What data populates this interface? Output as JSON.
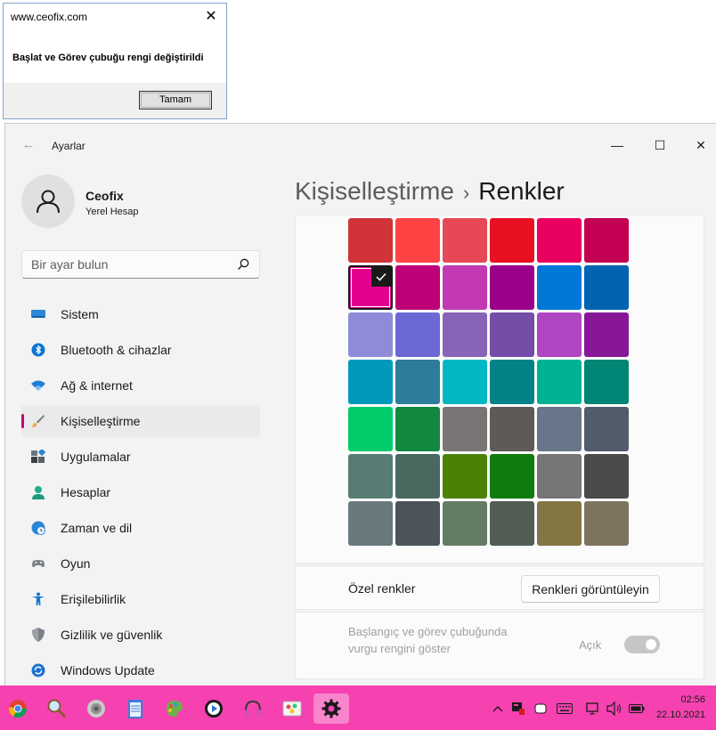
{
  "msgbox": {
    "title": "www.ceofix.com",
    "message": "Başlat ve Görev çubuğu rengi değiştirildi",
    "ok_label": "Tamam"
  },
  "settings": {
    "app_title": "Ayarlar",
    "profile": {
      "name": "Ceofix",
      "account_type": "Yerel Hesap"
    },
    "search": {
      "placeholder": "Bir ayar bulun"
    },
    "nav": [
      {
        "label": "Sistem",
        "icon": "monitor-icon",
        "active": false
      },
      {
        "label": "Bluetooth & cihazlar",
        "icon": "bluetooth-icon",
        "active": false
      },
      {
        "label": "Ağ & internet",
        "icon": "wifi-icon",
        "active": false
      },
      {
        "label": "Kişiselleştirme",
        "icon": "brush-icon",
        "active": true
      },
      {
        "label": "Uygulamalar",
        "icon": "apps-icon",
        "active": false
      },
      {
        "label": "Hesaplar",
        "icon": "person-icon",
        "active": false
      },
      {
        "label": "Zaman ve dil",
        "icon": "globe-clock-icon",
        "active": false
      },
      {
        "label": "Oyun",
        "icon": "gamepad-icon",
        "active": false
      },
      {
        "label": "Erişilebilirlik",
        "icon": "accessibility-icon",
        "active": false
      },
      {
        "label": "Gizlilik ve güvenlik",
        "icon": "shield-icon",
        "active": false
      },
      {
        "label": "Windows Update",
        "icon": "update-icon",
        "active": false
      }
    ],
    "breadcrumb": {
      "parent": "Kişiselleştirme",
      "separator": "›",
      "current": "Renkler"
    },
    "swatch_colors": [
      "#d13438",
      "#ff4343",
      "#e74856",
      "#e81123",
      "#ea005e",
      "#c30052",
      "#e3008c",
      "#bf0077",
      "#c239b3",
      "#9a0089",
      "#0078d7",
      "#0063b1",
      "#8e8cd8",
      "#6b69d6",
      "#8764b8",
      "#744da9",
      "#b146c2",
      "#881798",
      "#0099bc",
      "#2d7d9a",
      "#00b7c3",
      "#038387",
      "#00b294",
      "#018574",
      "#00cc6a",
      "#10893e",
      "#7a7574",
      "#5d5a58",
      "#68768a",
      "#515c6b",
      "#567c73",
      "#486860",
      "#498205",
      "#107c10",
      "#767676",
      "#4c4a48",
      "#69797e",
      "#4a5459",
      "#647c64",
      "#525e54",
      "#847545",
      "#7e735f"
    ],
    "selected_swatch_index": 6,
    "custom_colors": {
      "label": "Özel renkler",
      "button_label": "Renkleri görüntüleyin"
    },
    "accent_start": {
      "label": "Başlangıç ve görev çubuğunda vurgu rengini göster",
      "state_label": "Açık",
      "enabled": false
    }
  },
  "taskbar": {
    "apps": [
      "chrome-icon",
      "search-magnifier-icon",
      "speaker-app-icon",
      "notepad-icon",
      "paint-icon",
      "media-player-icon",
      "headset-icon",
      "photo-viewer-icon",
      "settings-gear-icon"
    ],
    "active_app_index": 8,
    "time": "02:56",
    "date": "22.10.2021"
  }
}
